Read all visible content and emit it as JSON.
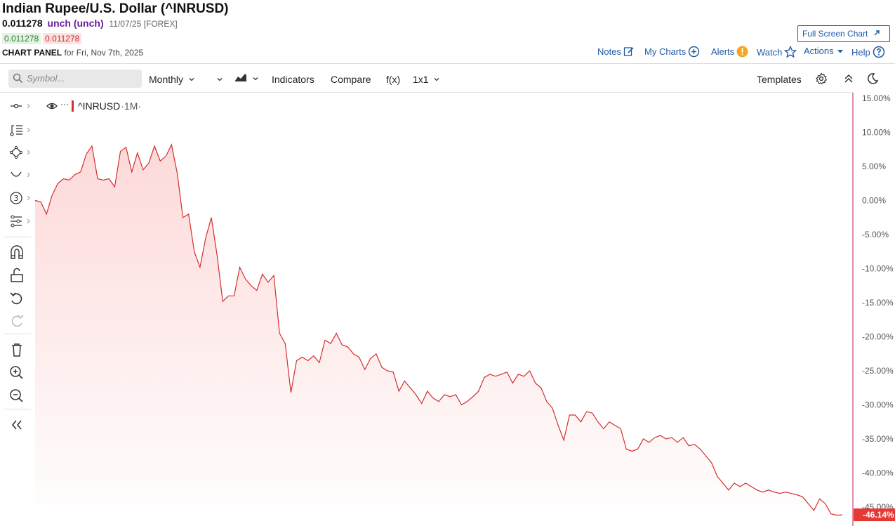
{
  "header": {
    "title": "Indian Rupee/U.S. Dollar (^INRUSD)",
    "price": "0.011278",
    "change": "unch (unch)",
    "date_meta": "11/07/25 [FOREX]",
    "bid": "0.011278",
    "ask": "0.011278",
    "panel_label": "CHART PANEL",
    "panel_date": "for Fri, Nov 7th, 2025",
    "fullscreen_label": "Full Screen Chart",
    "links": {
      "notes": "Notes",
      "my_charts": "My Charts",
      "alerts": "Alerts",
      "watch": "Watch",
      "actions": "Actions",
      "help": "Help"
    }
  },
  "toolbar": {
    "symbol_placeholder": "Symbol...",
    "interval": "Monthly",
    "indicators": "Indicators",
    "compare": "Compare",
    "fx": "f(x)",
    "layout": "1x1",
    "templates": "Templates"
  },
  "colors": {
    "line": "#d32f2f",
    "fill_top": "#fdd9d9",
    "fill_bottom": "#ffffff",
    "link": "#1f5aa6",
    "axis_line": "#c2185b",
    "last_badge": "#e53935"
  },
  "sidebar_icons": [
    "line-tool-icon",
    "fib-tool-icon",
    "shape-tool-icon",
    "curve-tool-icon",
    "number-tool-icon",
    "pattern-tool-icon",
    "magnet-icon",
    "lock-icon",
    "undo-icon",
    "redo-icon",
    "trash-icon",
    "zoom-in-icon",
    "zoom-out-icon",
    "collapse-icon"
  ],
  "chart_data": {
    "type": "area",
    "series_label": "^INRUSD",
    "interval_label": "·1M·",
    "yaxis_ticks": [
      "15.00%",
      "10.00%",
      "5.00%",
      "0.00%",
      "-5.00%",
      "-10.00%",
      "-15.00%",
      "-20.00%",
      "-25.00%",
      "-30.00%",
      "-35.00%",
      "-40.00%",
      "-45.00%"
    ],
    "ylim": [
      -47,
      15.5
    ],
    "last_value_label": "-46.14%",
    "series": [
      {
        "values": [
          0.0,
          -0.2,
          -2.0,
          0.8,
          2.5,
          3.2,
          3.0,
          3.8,
          4.2,
          6.8,
          8.0,
          3.2,
          3.0,
          3.2,
          2.0,
          7.2,
          7.8,
          4.2,
          7.0,
          4.5,
          5.5,
          8.0,
          5.8,
          6.5,
          8.2,
          4.0,
          -2.5,
          -2.0,
          -7.5,
          -9.8,
          -5.5,
          -2.5,
          -8.0,
          -14.8,
          -14.0,
          -14.0,
          -9.8,
          -11.5,
          -12.5,
          -13.2,
          -10.8,
          -12.0,
          -11.0,
          -19.5,
          -21.0,
          -28.2,
          -23.5,
          -23.0,
          -23.5,
          -22.8,
          -23.8,
          -20.5,
          -21.0,
          -19.5,
          -21.2,
          -21.5,
          -22.5,
          -23.0,
          -24.8,
          -23.2,
          -22.5,
          -24.5,
          -25.0,
          -25.2,
          -28.0,
          -26.5,
          -27.5,
          -28.5,
          -29.8,
          -28.0,
          -29.0,
          -29.5,
          -28.5,
          -28.8,
          -28.5,
          -30.0,
          -29.5,
          -28.8,
          -28.0,
          -26.0,
          -25.5,
          -25.8,
          -25.5,
          -25.2,
          -26.8,
          -25.5,
          -25.8,
          -25.0,
          -26.8,
          -27.5,
          -29.5,
          -30.5,
          -33.0,
          -35.2,
          -31.5,
          -31.5,
          -32.5,
          -31.0,
          -31.2,
          -32.5,
          -33.5,
          -32.5,
          -33.0,
          -33.5,
          -36.5,
          -36.8,
          -36.5,
          -35.0,
          -35.5,
          -34.8,
          -34.5,
          -35.0,
          -34.8,
          -35.5,
          -34.8,
          -36.0,
          -35.8,
          -36.5,
          -37.5,
          -38.5,
          -40.5,
          -41.5,
          -42.5,
          -41.5,
          -42.0,
          -41.5,
          -42.0,
          -42.5,
          -42.8,
          -42.5,
          -42.8,
          -43.0,
          -42.8,
          -43.0,
          -43.2,
          -43.5,
          -44.5,
          -45.5,
          -43.8,
          -44.5,
          -46.0,
          -46.2,
          -46.14
        ]
      }
    ]
  }
}
